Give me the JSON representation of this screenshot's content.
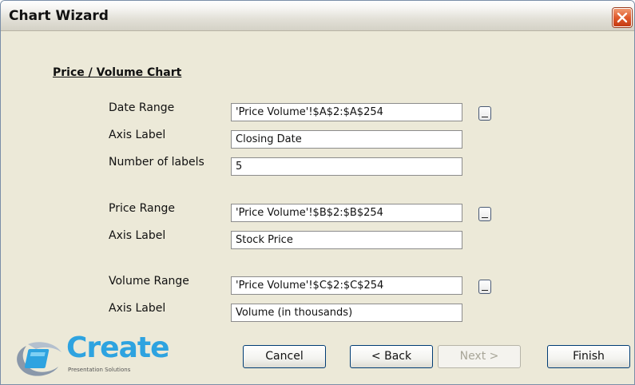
{
  "window": {
    "title": "Chart Wizard"
  },
  "section_title": "Price / Volume Chart",
  "rows": [
    {
      "label": "Date Range",
      "value": "'Price Volume'!$A$2:$A$254"
    },
    {
      "label": "Axis Label",
      "value": "Closing Date"
    },
    {
      "label": "Number of labels",
      "value": "5"
    },
    {
      "label": "Price Range",
      "value": "'Price Volume'!$B$2:$B$254"
    },
    {
      "label": "Axis Label",
      "value": "Stock Price"
    },
    {
      "label": "Volume Range",
      "value": "'Price Volume'!$C$2:$C$254"
    },
    {
      "label": "Axis Label",
      "value": "Volume (in thousands)"
    }
  ],
  "buttons": {
    "cancel": "Cancel",
    "back": "< Back",
    "next": "Next >",
    "finish": "Finish"
  },
  "logo": {
    "word": "Create",
    "sub": "Presentation Solutions"
  },
  "colors": {
    "logo_blue": "#2ea3e0",
    "close_red": "#e05a2c"
  }
}
